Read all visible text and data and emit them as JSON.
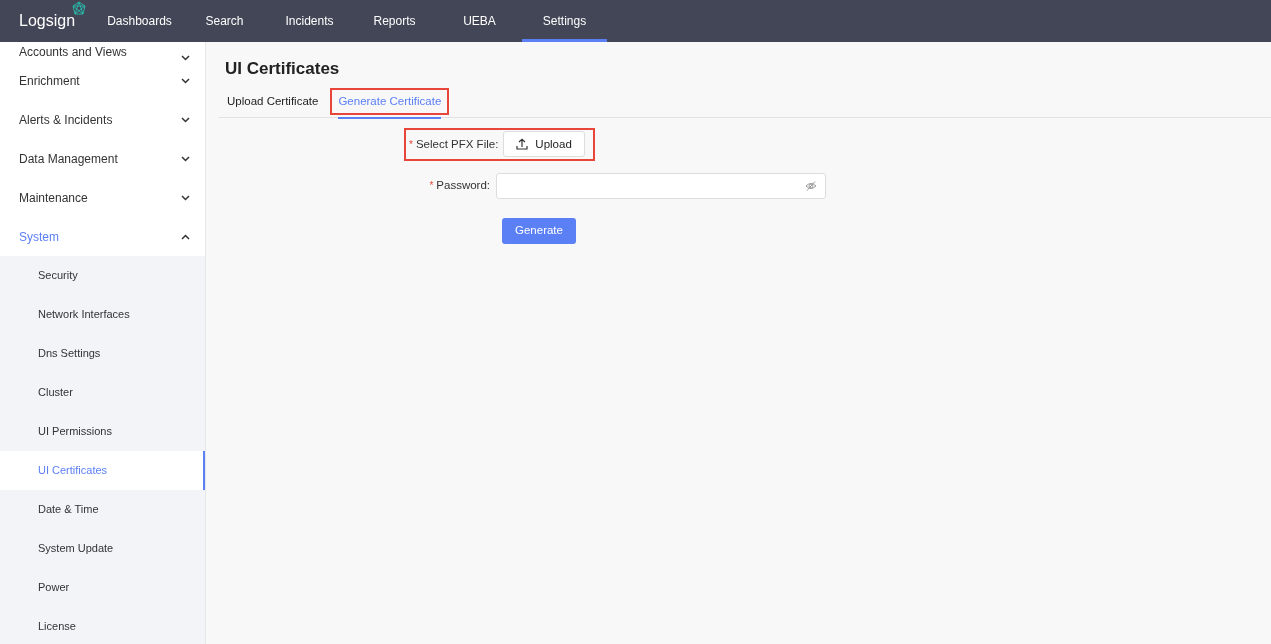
{
  "header": {
    "logo": "Logsign",
    "nav": [
      {
        "label": "Dashboards",
        "selected": false
      },
      {
        "label": "Search",
        "selected": false
      },
      {
        "label": "Incidents",
        "selected": false
      },
      {
        "label": "Reports",
        "selected": false
      },
      {
        "label": "UEBA",
        "selected": false
      },
      {
        "label": "Settings",
        "selected": true
      }
    ]
  },
  "sidebar": {
    "items": [
      {
        "label": "Accounts and Views",
        "expanded": false,
        "selected": false
      },
      {
        "label": "Enrichment",
        "expanded": false,
        "selected": false
      },
      {
        "label": "Alerts & Incidents",
        "expanded": false,
        "selected": false
      },
      {
        "label": "Data Management",
        "expanded": false,
        "selected": false
      },
      {
        "label": "Maintenance",
        "expanded": false,
        "selected": false
      },
      {
        "label": "System",
        "expanded": true,
        "selected": true,
        "children": [
          {
            "label": "Security",
            "selected": false
          },
          {
            "label": "Network Interfaces",
            "selected": false
          },
          {
            "label": "Dns Settings",
            "selected": false
          },
          {
            "label": "Cluster",
            "selected": false
          },
          {
            "label": "UI Permissions",
            "selected": false
          },
          {
            "label": "UI Certificates",
            "selected": true
          },
          {
            "label": "Date & Time",
            "selected": false
          },
          {
            "label": "System Update",
            "selected": false
          },
          {
            "label": "Power",
            "selected": false
          },
          {
            "label": "License",
            "selected": false
          }
        ]
      }
    ]
  },
  "page": {
    "title": "UI Certificates",
    "tabs": [
      {
        "label": "Upload Certificate",
        "selected": false,
        "highlighted": false
      },
      {
        "label": "Generate Certificate",
        "selected": true,
        "highlighted": true
      }
    ],
    "form": {
      "pfx": {
        "label": "Select PFX File:",
        "required": true,
        "required_mark": "*",
        "button": "Upload",
        "highlighted": true
      },
      "password": {
        "label": "Password:",
        "required": true,
        "required_mark": "*"
      },
      "submit": "Generate"
    }
  }
}
